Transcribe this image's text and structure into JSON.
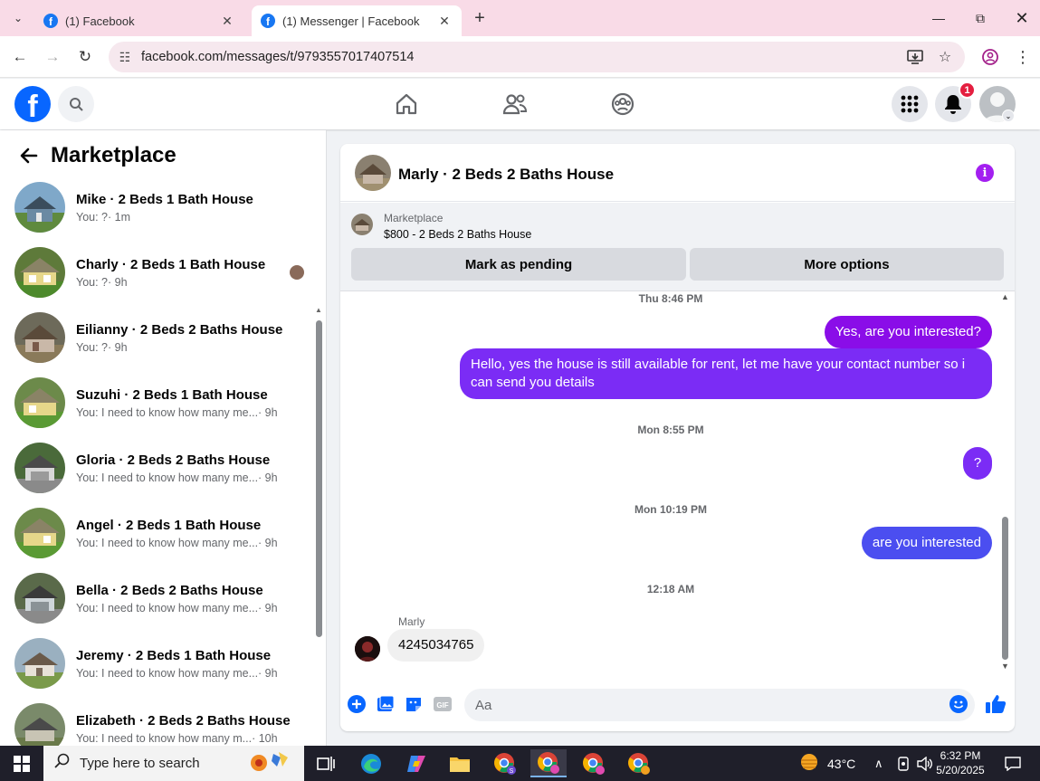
{
  "browser": {
    "tabs": [
      {
        "title": "(1) Facebook",
        "active": false
      },
      {
        "title": "(1) Messenger | Facebook",
        "active": true
      }
    ],
    "url": "facebook.com/messages/t/9793557017407514"
  },
  "header": {
    "notification_count": "1"
  },
  "sidebar": {
    "title": "Marketplace",
    "conversations": [
      {
        "name": "Mike · 2 Beds 1 Bath House",
        "preview": "You: ?",
        "time": " · 1m"
      },
      {
        "name": "Charly · 2 Beds 1 Bath House",
        "preview": "You: ?",
        "time": " · 9h"
      },
      {
        "name": "Eilianny · 2 Beds 2 Baths House",
        "preview": "You: ?",
        "time": " · 9h"
      },
      {
        "name": "Suzuhi · 2 Beds 1 Bath House",
        "preview": "You: I need to know how many me...",
        "time": " · 9h"
      },
      {
        "name": "Gloria · 2 Beds 2 Baths House",
        "preview": "You: I need to know how many me...",
        "time": " · 9h"
      },
      {
        "name": "Angel · 2 Beds 1 Bath House",
        "preview": "You: I need to know how many me...",
        "time": " · 9h"
      },
      {
        "name": "Bella · 2 Beds 2 Baths House",
        "preview": "You: I need to know how many me...",
        "time": " · 9h"
      },
      {
        "name": "Jeremy · 2 Beds 1 Bath House",
        "preview": "You: I need to know how many me...",
        "time": " · 9h"
      },
      {
        "name": "Elizabeth · 2 Beds 2 Baths House",
        "preview": "You: I need to know how many m...",
        "time": " · 10h"
      }
    ]
  },
  "chat": {
    "title": "Marly · 2 Beds 2 Baths House",
    "marketplace_label": "Marketplace",
    "listing": "$800 - 2 Beds 2 Baths House",
    "mark_pending": "Mark as pending",
    "more_options": "More options",
    "messages": {
      "ts1": "Thu 8:46 PM",
      "m1": "Yes, are you interested?",
      "m2": "Hello, yes the house is still available for rent, let me have your contact number so i can send you  details",
      "ts2": "Mon 8:55 PM",
      "m3": "?",
      "ts3": "Mon 10:19 PM",
      "m4": "are you interested",
      "ts4": "12:18 AM",
      "sender": "Marly",
      "m5": "4245034765"
    },
    "composer_placeholder": "Aa"
  },
  "taskbar": {
    "search_placeholder": "Type here to search",
    "temperature": "43°C",
    "time": "6:32 PM",
    "date": "5/20/2025"
  },
  "colors": {
    "fb_blue": "#0866ff",
    "bubble_purple": "#8a0de8",
    "bubble_blue": "#4b4ef0",
    "accent_violet": "#a31ff0"
  }
}
